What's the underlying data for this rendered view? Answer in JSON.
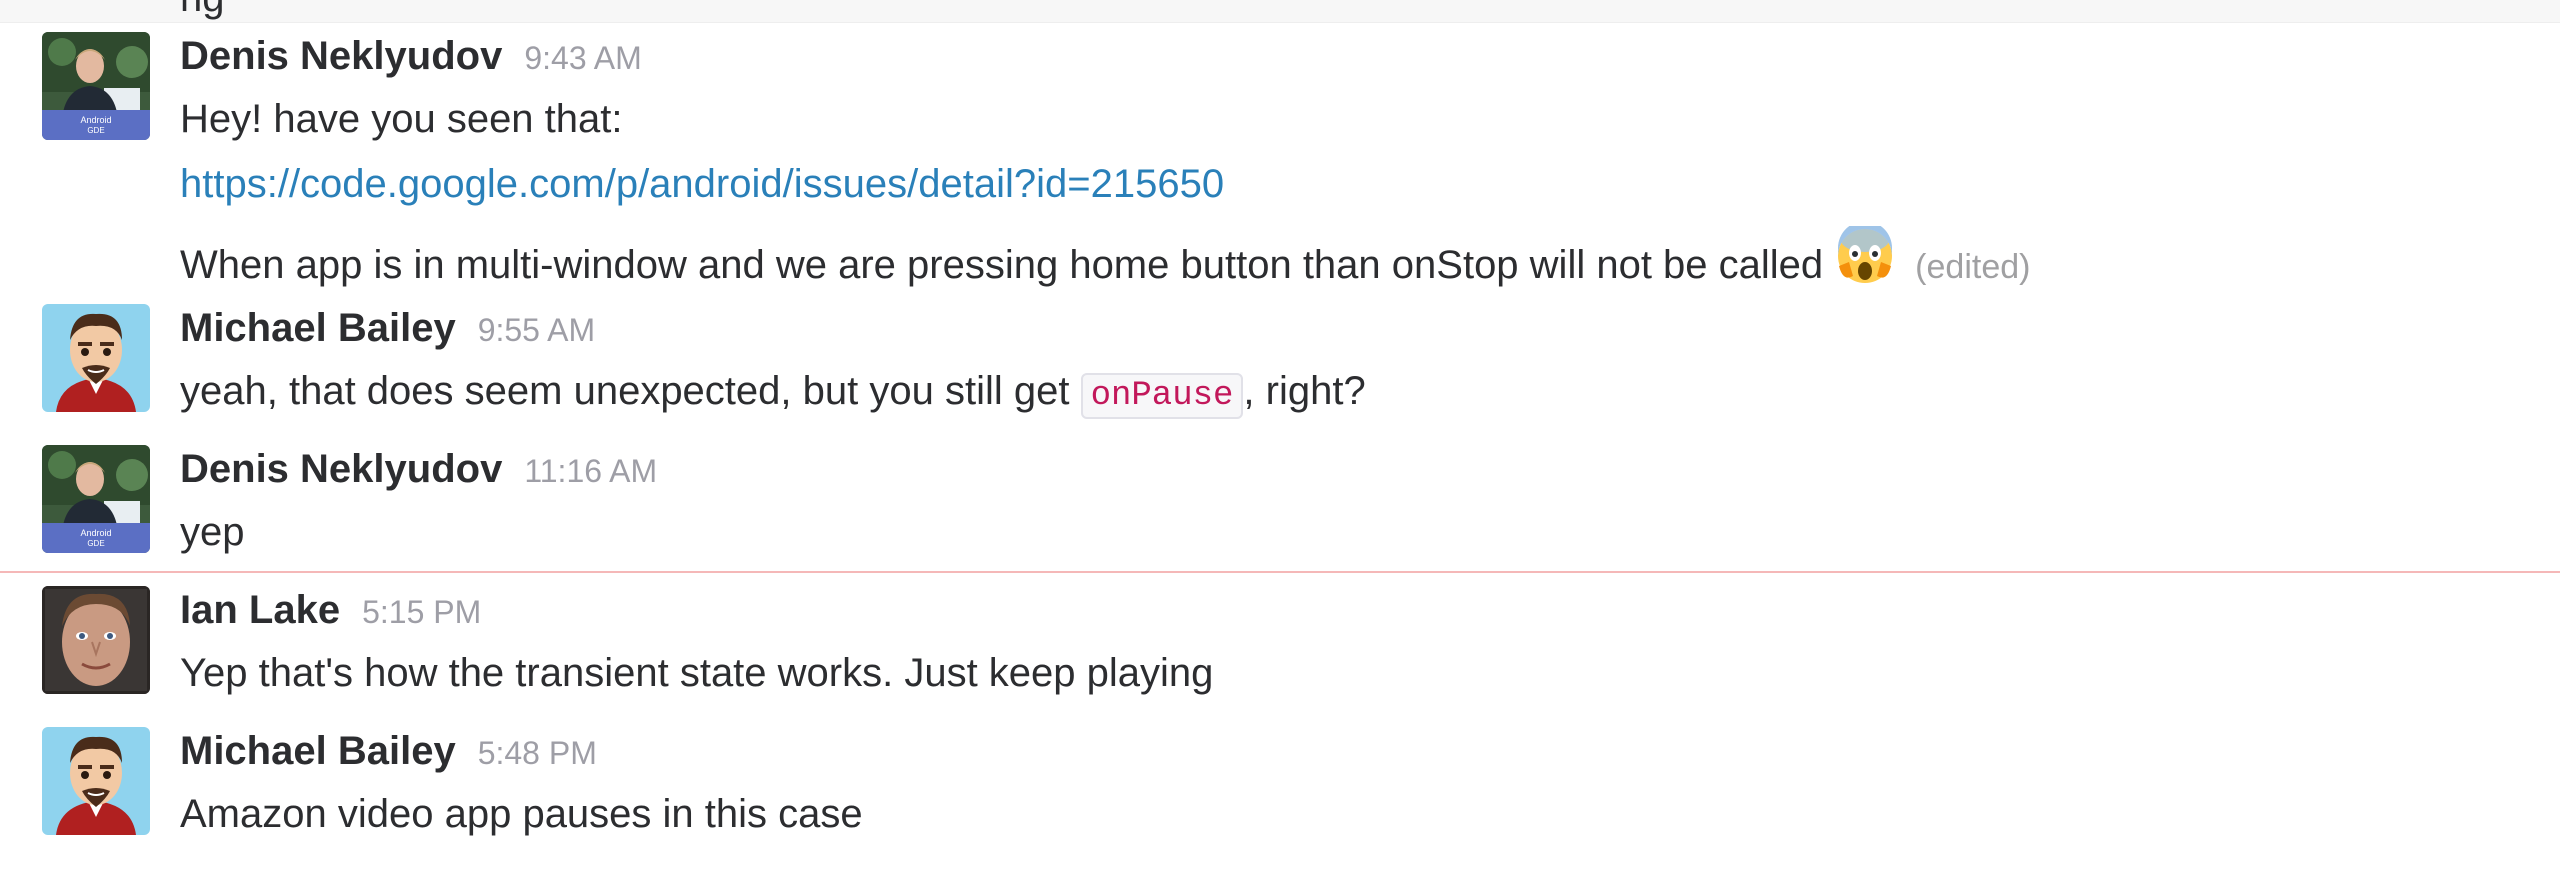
{
  "header_fragment": "ng",
  "messages": [
    {
      "author": "Denis Neklyudov",
      "time": "9:43 AM",
      "avatar_badge_line1": "Android",
      "avatar_badge_line2": "GDE",
      "line1": "Hey! have you seen that:",
      "link": "https://code.google.com/p/android/issues/detail?id=215650",
      "line3": "When app is in multi-window and we are pressing home button than onStop will not be called",
      "emoji": "scream-emoji",
      "edited": "(edited)"
    },
    {
      "author": "Michael Bailey",
      "time": "9:55 AM",
      "text_before": "yeah, that does seem unexpected, but you still get ",
      "code": "onPause",
      "text_after": ", right?"
    },
    {
      "author": "Denis Neklyudov",
      "time": "11:16 AM",
      "avatar_badge_line1": "Android",
      "avatar_badge_line2": "GDE",
      "text": "yep"
    },
    {
      "author": "Ian Lake",
      "time": "5:15 PM",
      "text": "Yep that's how the transient state works. Just keep playing"
    },
    {
      "author": "Michael Bailey",
      "time": "5:48 PM",
      "text": "Amazon video app pauses in this case"
    }
  ],
  "colors": {
    "link": "#2a80b9",
    "code_text": "#c2185b",
    "timestamp": "#9e9ea6",
    "new_messages_divider": "#f5b8b8"
  }
}
